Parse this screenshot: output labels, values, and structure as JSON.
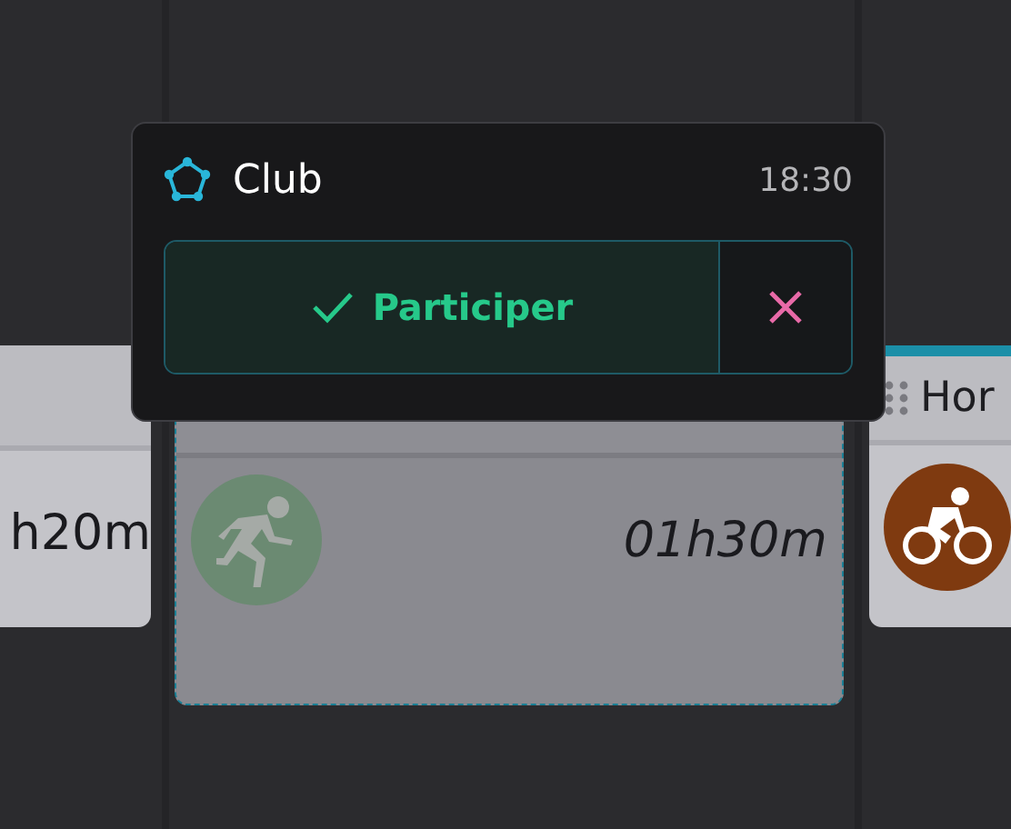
{
  "cards": [
    {
      "kind": "plain",
      "duration": "h20m"
    },
    {
      "kind": "placeholder",
      "duration": "01h30m",
      "color": "#6b8a72"
    },
    {
      "kind": "titled",
      "title": "Hor",
      "color": "#7f3a10"
    }
  ],
  "popover": {
    "title": "Club",
    "time": "18:30",
    "accept_button": "Participer"
  }
}
